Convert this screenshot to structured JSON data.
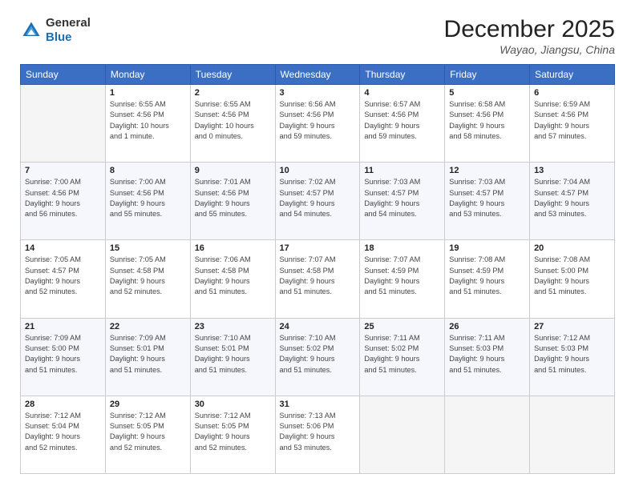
{
  "app": {
    "logo_line1": "General",
    "logo_line2": "Blue"
  },
  "header": {
    "month": "December 2025",
    "location": "Wayao, Jiangsu, China"
  },
  "weekdays": [
    "Sunday",
    "Monday",
    "Tuesday",
    "Wednesday",
    "Thursday",
    "Friday",
    "Saturday"
  ],
  "weeks": [
    [
      {
        "day": "",
        "info": ""
      },
      {
        "day": "1",
        "info": "Sunrise: 6:55 AM\nSunset: 4:56 PM\nDaylight: 10 hours\nand 1 minute."
      },
      {
        "day": "2",
        "info": "Sunrise: 6:55 AM\nSunset: 4:56 PM\nDaylight: 10 hours\nand 0 minutes."
      },
      {
        "day": "3",
        "info": "Sunrise: 6:56 AM\nSunset: 4:56 PM\nDaylight: 9 hours\nand 59 minutes."
      },
      {
        "day": "4",
        "info": "Sunrise: 6:57 AM\nSunset: 4:56 PM\nDaylight: 9 hours\nand 59 minutes."
      },
      {
        "day": "5",
        "info": "Sunrise: 6:58 AM\nSunset: 4:56 PM\nDaylight: 9 hours\nand 58 minutes."
      },
      {
        "day": "6",
        "info": "Sunrise: 6:59 AM\nSunset: 4:56 PM\nDaylight: 9 hours\nand 57 minutes."
      }
    ],
    [
      {
        "day": "7",
        "info": "Sunrise: 7:00 AM\nSunset: 4:56 PM\nDaylight: 9 hours\nand 56 minutes."
      },
      {
        "day": "8",
        "info": "Sunrise: 7:00 AM\nSunset: 4:56 PM\nDaylight: 9 hours\nand 55 minutes."
      },
      {
        "day": "9",
        "info": "Sunrise: 7:01 AM\nSunset: 4:56 PM\nDaylight: 9 hours\nand 55 minutes."
      },
      {
        "day": "10",
        "info": "Sunrise: 7:02 AM\nSunset: 4:57 PM\nDaylight: 9 hours\nand 54 minutes."
      },
      {
        "day": "11",
        "info": "Sunrise: 7:03 AM\nSunset: 4:57 PM\nDaylight: 9 hours\nand 54 minutes."
      },
      {
        "day": "12",
        "info": "Sunrise: 7:03 AM\nSunset: 4:57 PM\nDaylight: 9 hours\nand 53 minutes."
      },
      {
        "day": "13",
        "info": "Sunrise: 7:04 AM\nSunset: 4:57 PM\nDaylight: 9 hours\nand 53 minutes."
      }
    ],
    [
      {
        "day": "14",
        "info": "Sunrise: 7:05 AM\nSunset: 4:57 PM\nDaylight: 9 hours\nand 52 minutes."
      },
      {
        "day": "15",
        "info": "Sunrise: 7:05 AM\nSunset: 4:58 PM\nDaylight: 9 hours\nand 52 minutes."
      },
      {
        "day": "16",
        "info": "Sunrise: 7:06 AM\nSunset: 4:58 PM\nDaylight: 9 hours\nand 51 minutes."
      },
      {
        "day": "17",
        "info": "Sunrise: 7:07 AM\nSunset: 4:58 PM\nDaylight: 9 hours\nand 51 minutes."
      },
      {
        "day": "18",
        "info": "Sunrise: 7:07 AM\nSunset: 4:59 PM\nDaylight: 9 hours\nand 51 minutes."
      },
      {
        "day": "19",
        "info": "Sunrise: 7:08 AM\nSunset: 4:59 PM\nDaylight: 9 hours\nand 51 minutes."
      },
      {
        "day": "20",
        "info": "Sunrise: 7:08 AM\nSunset: 5:00 PM\nDaylight: 9 hours\nand 51 minutes."
      }
    ],
    [
      {
        "day": "21",
        "info": "Sunrise: 7:09 AM\nSunset: 5:00 PM\nDaylight: 9 hours\nand 51 minutes."
      },
      {
        "day": "22",
        "info": "Sunrise: 7:09 AM\nSunset: 5:01 PM\nDaylight: 9 hours\nand 51 minutes."
      },
      {
        "day": "23",
        "info": "Sunrise: 7:10 AM\nSunset: 5:01 PM\nDaylight: 9 hours\nand 51 minutes."
      },
      {
        "day": "24",
        "info": "Sunrise: 7:10 AM\nSunset: 5:02 PM\nDaylight: 9 hours\nand 51 minutes."
      },
      {
        "day": "25",
        "info": "Sunrise: 7:11 AM\nSunset: 5:02 PM\nDaylight: 9 hours\nand 51 minutes."
      },
      {
        "day": "26",
        "info": "Sunrise: 7:11 AM\nSunset: 5:03 PM\nDaylight: 9 hours\nand 51 minutes."
      },
      {
        "day": "27",
        "info": "Sunrise: 7:12 AM\nSunset: 5:03 PM\nDaylight: 9 hours\nand 51 minutes."
      }
    ],
    [
      {
        "day": "28",
        "info": "Sunrise: 7:12 AM\nSunset: 5:04 PM\nDaylight: 9 hours\nand 52 minutes."
      },
      {
        "day": "29",
        "info": "Sunrise: 7:12 AM\nSunset: 5:05 PM\nDaylight: 9 hours\nand 52 minutes."
      },
      {
        "day": "30",
        "info": "Sunrise: 7:12 AM\nSunset: 5:05 PM\nDaylight: 9 hours\nand 52 minutes."
      },
      {
        "day": "31",
        "info": "Sunrise: 7:13 AM\nSunset: 5:06 PM\nDaylight: 9 hours\nand 53 minutes."
      },
      {
        "day": "",
        "info": ""
      },
      {
        "day": "",
        "info": ""
      },
      {
        "day": "",
        "info": ""
      }
    ]
  ]
}
